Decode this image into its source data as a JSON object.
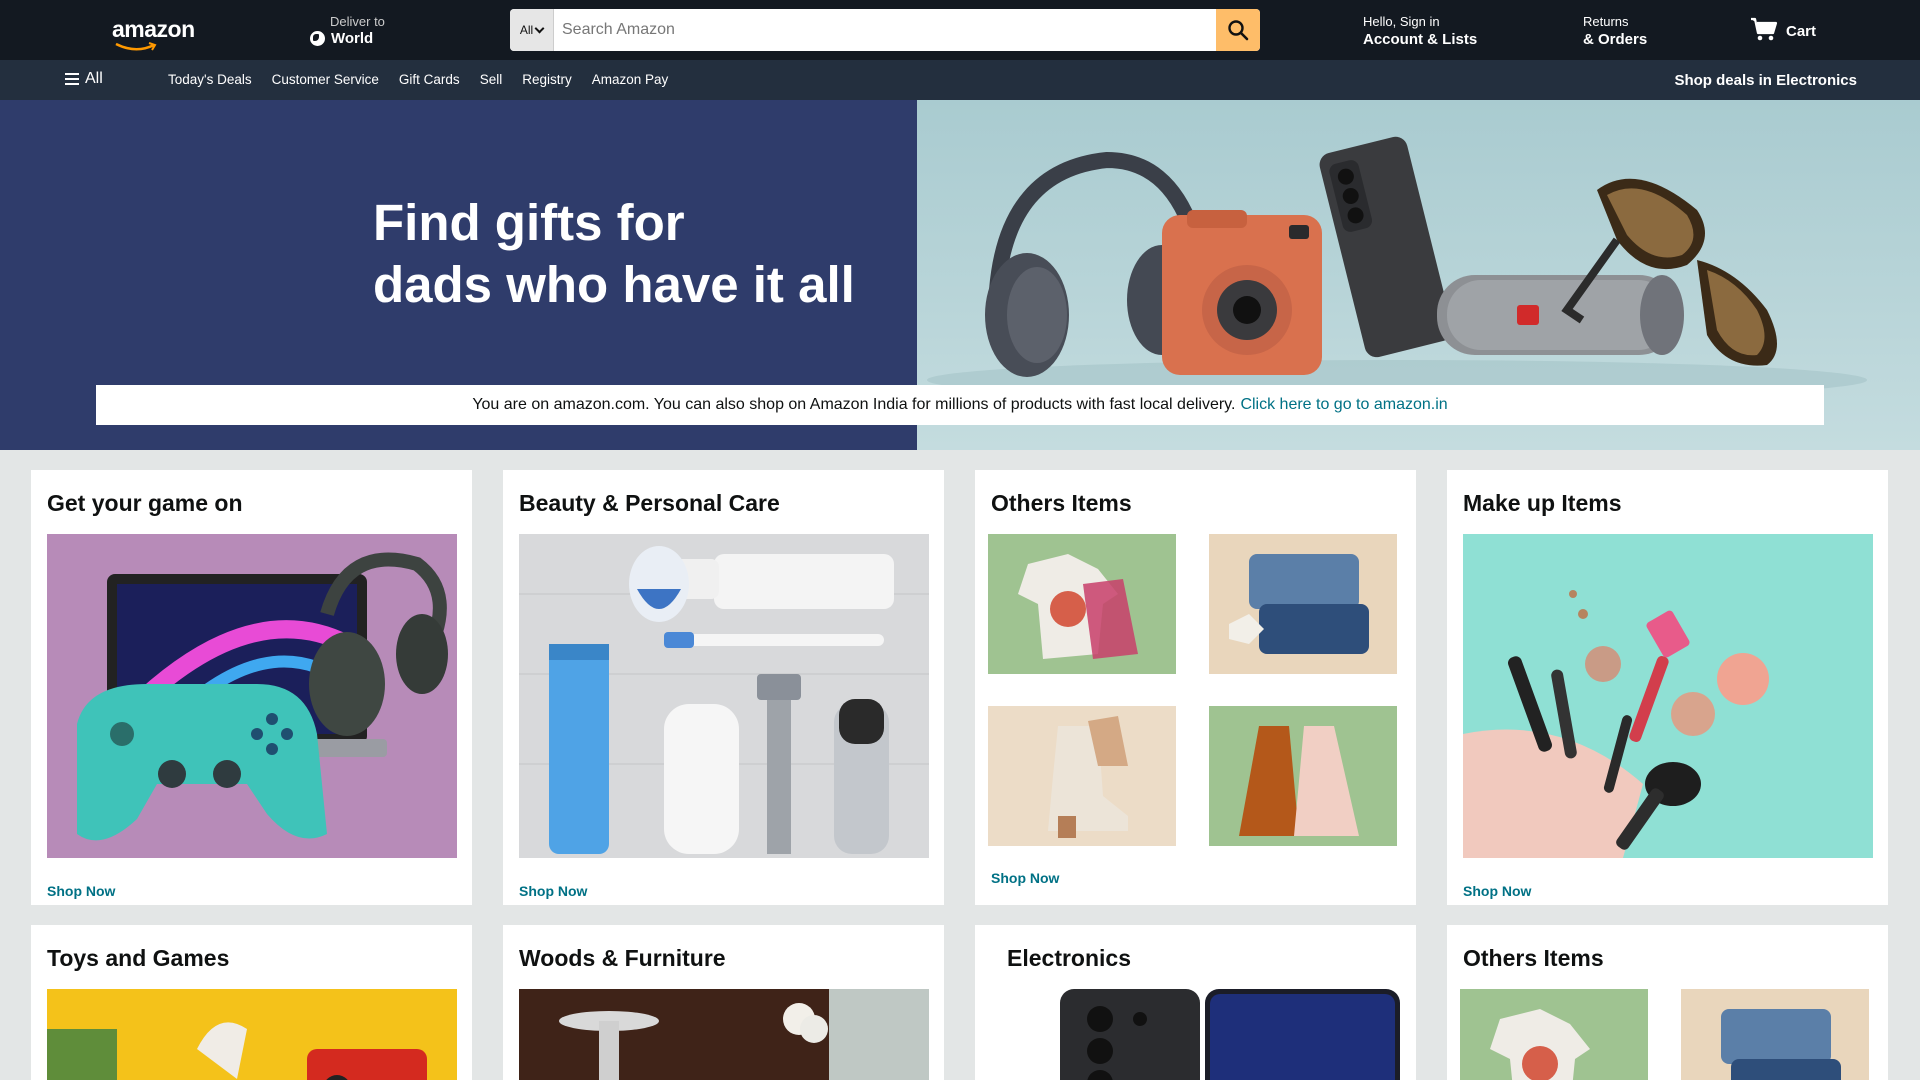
{
  "header": {
    "logo": "amazon",
    "deliver_label": "Deliver to",
    "deliver_location": "World",
    "search_category": "All",
    "search_placeholder": "Search Amazon",
    "signin_greeting": "Hello, Sign in",
    "account_label": "Account & Lists",
    "returns_label": "Returns",
    "orders_label": "& Orders",
    "cart_label": "Cart"
  },
  "subnav": {
    "all_label": "All",
    "links": [
      "Today's Deals",
      "Customer Service",
      "Gift Cards",
      "Sell",
      "Registry",
      "Amazon Pay"
    ],
    "promo": "Shop deals in Electronics"
  },
  "hero": {
    "headline_line1": "Find gifts for",
    "headline_line2": "dads who have it all",
    "notice_text": "You are on amazon.com. You can also shop on Amazon India for millions of products with fast local delivery.",
    "notice_link": "Click here to go to amazon.in"
  },
  "cards": [
    {
      "title": "Get your game on",
      "cta": "Shop Now"
    },
    {
      "title": "Beauty & Personal Care",
      "cta": "Shop Now"
    },
    {
      "title": "Others Items",
      "cta": "Shop Now"
    },
    {
      "title": "Make up Items",
      "cta": "Shop Now"
    },
    {
      "title": "Toys and Games"
    },
    {
      "title": "Woods & Furniture"
    },
    {
      "title": "Electronics"
    },
    {
      "title": "Others Items"
    }
  ],
  "colors": {
    "nav_bg": "#131921",
    "subnav_bg": "#232f3e",
    "search_button": "#febd69",
    "link": "#007185",
    "hero_left": "#2f3c6b"
  }
}
